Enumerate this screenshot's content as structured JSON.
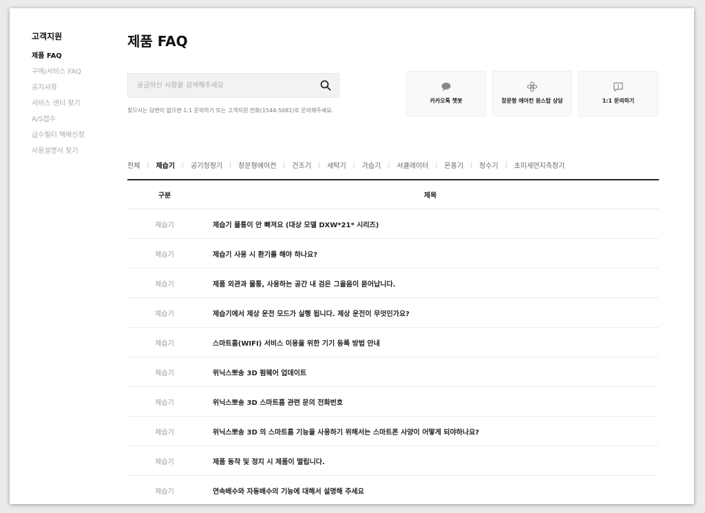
{
  "sidebar": {
    "title": "고객지원",
    "items": [
      {
        "label": "제품 FAQ"
      },
      {
        "label": "구매/서비스 FAQ"
      },
      {
        "label": "공지사항"
      },
      {
        "label": "서비스 센터 찾기"
      },
      {
        "label": "A/S접수"
      },
      {
        "label": "급수필터 택배신청"
      },
      {
        "label": "사용설명서 찾기"
      }
    ]
  },
  "page": {
    "title": "제품 FAQ"
  },
  "search": {
    "placeholder": "궁금하신 사항을 검색해주세요",
    "value": "",
    "notice": "찾으시는 답변이 없으면 1:1 문의하기 또는 고객지원 전화(1544-5081)로 문의해주세요."
  },
  "quick_links": [
    {
      "label": "카카오톡 챗봇",
      "icon": "chat-bubble-icon"
    },
    {
      "label": "창문형 에어컨 원스탑 상담",
      "icon": "fan-icon"
    },
    {
      "label": "1:1 문의하기",
      "icon": "alert-message-icon"
    }
  ],
  "categories": [
    "전체",
    "제습기",
    "공기청정기",
    "창문형에어컨",
    "건조기",
    "세탁기",
    "가습기",
    "서큘레이터",
    "온풍기",
    "정수기",
    "초미세먼지측정기"
  ],
  "active_category": "제습기",
  "table": {
    "headers": {
      "category": "구분",
      "title": "제목"
    },
    "rows": [
      {
        "category": "제습기",
        "title": "제습기 물통이 안 빠져요 (대상 모델 DXW*21* 시리즈)"
      },
      {
        "category": "제습기",
        "title": "제습기 사용 시 환기를 해야 하나요?"
      },
      {
        "category": "제습기",
        "title": "제품 외관과 물통, 사용하는 공간 내 검은 그을음이 묻어납니다."
      },
      {
        "category": "제습기",
        "title": "제습기에서 제상 운전 모드가 실행 됩니다. 제상 운전이 무엇인가요?"
      },
      {
        "category": "제습기",
        "title": "스마트홈(WIFI) 서비스 이용을 위한 기기 등록 방법 안내"
      },
      {
        "category": "제습기",
        "title": "위닉스뽀송 3D 펌웨어 업데이트"
      },
      {
        "category": "제습기",
        "title": "위닉스뽀송 3D 스마트홈 관련 문의 전화번호"
      },
      {
        "category": "제습기",
        "title": "위닉스뽀송 3D 의 스마트홈 기능을 사용하기 위해서는 스마트폰 사양이 어떻게 되야하나요?"
      },
      {
        "category": "제습기",
        "title": "제품 동작 및 정지 시 제품이 떨립니다."
      },
      {
        "category": "제습기",
        "title": "연속배수와 자동배수의 기능에 대해서 설명해 주세요"
      }
    ]
  },
  "colors": {
    "accent": "#111111",
    "muted": "#aaaaaa",
    "card_bg": "#faf9f7"
  }
}
